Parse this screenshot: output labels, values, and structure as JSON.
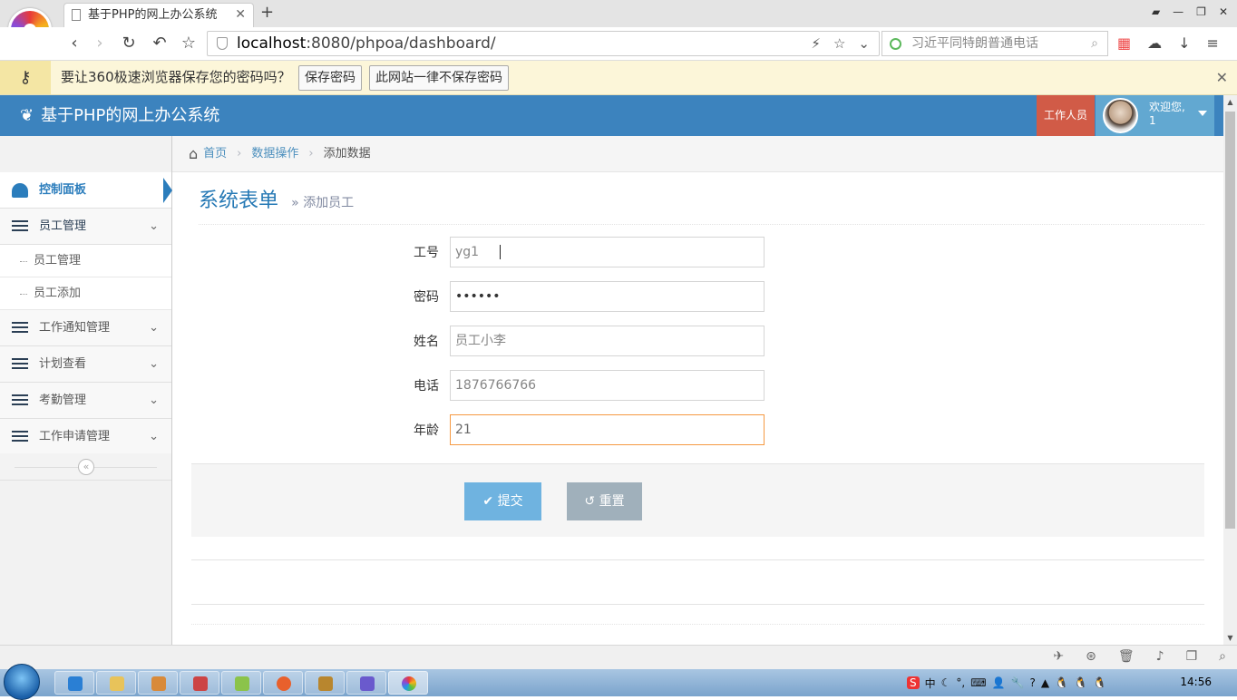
{
  "browser": {
    "tab_title": "基于PHP的网上办公系统",
    "address": {
      "host": "localhost",
      "path": ":8080/phpoa/dashboard/"
    },
    "search_placeholder": "习近平同特朗普通电话",
    "password_bar": {
      "message": "要让360极速浏览器保存您的密码吗？",
      "save_label": "保存密码",
      "never_label": "此网站一律不保存密码"
    }
  },
  "header": {
    "brand": "基于PHP的网上办公系统",
    "role": "工作人员",
    "welcome": "欢迎您,",
    "username": "1"
  },
  "sidebar": {
    "items": [
      {
        "label": "控制面板",
        "icon": "dashboard-icon"
      },
      {
        "label": "员工管理",
        "icon": "list-icon"
      },
      {
        "label": "工作通知管理",
        "icon": "list-icon"
      },
      {
        "label": "计划查看",
        "icon": "list-icon"
      },
      {
        "label": "考勤管理",
        "icon": "list-icon"
      },
      {
        "label": "工作申请管理",
        "icon": "list-icon"
      }
    ],
    "subitems": [
      {
        "label": "员工管理"
      },
      {
        "label": "员工添加"
      }
    ]
  },
  "breadcrumb": {
    "home": "首页",
    "section": "数据操作",
    "current": "添加数据"
  },
  "page": {
    "title": "系统表单",
    "subtitle": "添加员工"
  },
  "form": {
    "fields": [
      {
        "label": "工号",
        "value": "yg1"
      },
      {
        "label": "密码",
        "value": "••••••"
      },
      {
        "label": "姓名",
        "value": "员工小李"
      },
      {
        "label": "电话",
        "value": "1876766766"
      },
      {
        "label": "年龄",
        "value": "21"
      }
    ],
    "submit_label": "提交",
    "reset_label": "重置"
  },
  "taskbar": {
    "ime": "中",
    "clock": "14:56"
  },
  "colors": {
    "header_bg": "#3c83be",
    "role_badge": "#d15b47",
    "user_bg": "#62a8d1",
    "submit_btn": "#6fb3e0",
    "reset_btn": "#a0b0bb",
    "focus_border": "#f59942"
  }
}
